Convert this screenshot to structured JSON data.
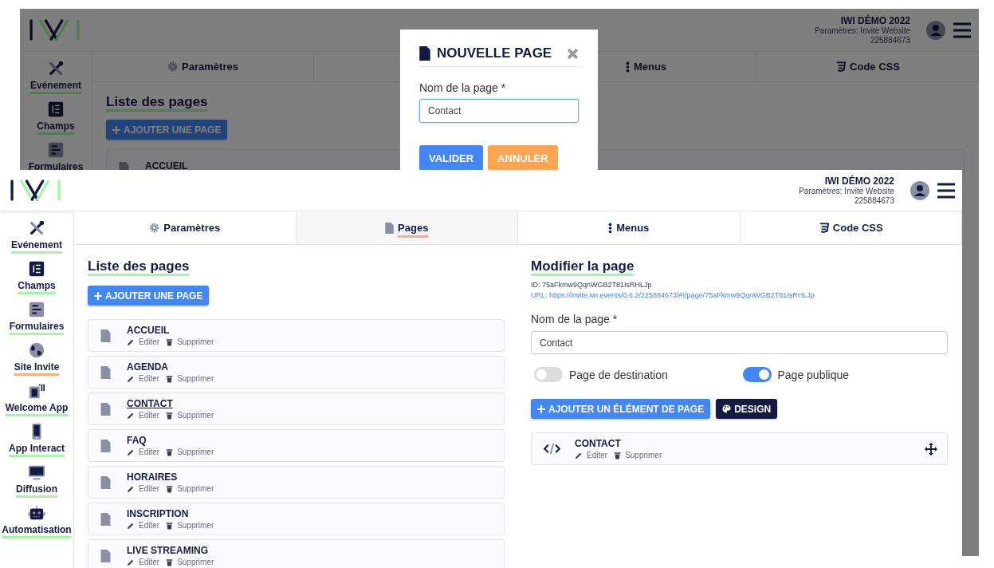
{
  "back_screen": {
    "header": {
      "event_title": "IWI DÉMO 2022",
      "event_subtitle": "Paramètres: Invite Website",
      "event_id": "225884673"
    },
    "tabs": [
      {
        "label": "Paramètres"
      },
      {
        "label": "Menus"
      },
      {
        "label": "Code CSS"
      }
    ],
    "sidebar": [
      {
        "label": "Evénement"
      },
      {
        "label": "Champs"
      },
      {
        "label": "Formulaires"
      }
    ],
    "heading": "Liste des pages",
    "add_button": "AJOUTER UNE PAGE",
    "pages": [
      {
        "title": "ACCUEIL"
      }
    ],
    "modal": {
      "title": "NOUVELLE PAGE",
      "field_label": "Nom de la page *",
      "field_value": "Contact",
      "buttons": [
        {
          "label": "VALIDER",
          "kind": "primary"
        },
        {
          "label": "ANNULER",
          "kind": "cancel"
        }
      ]
    }
  },
  "front_screen": {
    "header": {
      "event_title": "IWI DÉMO 2022",
      "event_subtitle": "Paramètres: Invite Website",
      "event_id": "225884673"
    },
    "tabs": [
      {
        "label": "Paramètres",
        "selected": false
      },
      {
        "label": "Pages",
        "selected": true
      },
      {
        "label": "Menus",
        "selected": false
      },
      {
        "label": "Code CSS",
        "selected": false
      }
    ],
    "sidebar": [
      {
        "label": "Evénement",
        "selected": false
      },
      {
        "label": "Champs",
        "selected": false
      },
      {
        "label": "Formulaires",
        "selected": false
      },
      {
        "label": "Site Invite",
        "selected": true
      },
      {
        "label": "Welcome App",
        "selected": false
      },
      {
        "label": "App Interact",
        "selected": false
      },
      {
        "label": "Diffusion",
        "selected": false
      },
      {
        "label": "Automatisation",
        "selected": false
      }
    ],
    "page_list": {
      "heading": "Liste des pages",
      "add_button": "AJOUTER UNE PAGE",
      "pages": [
        {
          "title": "ACCUEIL",
          "edit": "Editer",
          "delete": "Supprimer",
          "selected": false
        },
        {
          "title": "AGENDA",
          "edit": "Editer",
          "delete": "Supprimer",
          "selected": false
        },
        {
          "title": "CONTACT",
          "edit": "Editer",
          "delete": "Supprimer",
          "selected": true
        },
        {
          "title": "FAQ",
          "edit": "Editer",
          "delete": "Supprimer",
          "selected": false
        },
        {
          "title": "HORAIRES",
          "edit": "Editer",
          "delete": "Supprimer",
          "selected": false
        },
        {
          "title": "INSCRIPTION",
          "edit": "Editer",
          "delete": "Supprimer",
          "selected": false
        },
        {
          "title": "LIVE STREAMING",
          "edit": "Editer",
          "delete": "Supprimer",
          "selected": false
        }
      ]
    },
    "editor": {
      "heading": "Modifier la page",
      "id_line": "ID: 75aFkmw9QqnWGB2T81IsRHLJp",
      "url": "URL: https://invite.iwi.events/0.6.2/225884673/#!/page/75aFkmw9QqnWGB2T81IsRHLJp",
      "field_label": "Nom de la page *",
      "field_value": "Contact",
      "toggles": [
        {
          "label": "Page de destination",
          "on": false
        },
        {
          "label": "Page publique",
          "on": true
        }
      ],
      "add_element_button": "AJOUTER UN ÉLÉMENT DE PAGE",
      "design_button": "DESIGN",
      "elements": [
        {
          "title": "CONTACT",
          "edit": "Editer",
          "delete": "Supprimer"
        }
      ]
    }
  }
}
